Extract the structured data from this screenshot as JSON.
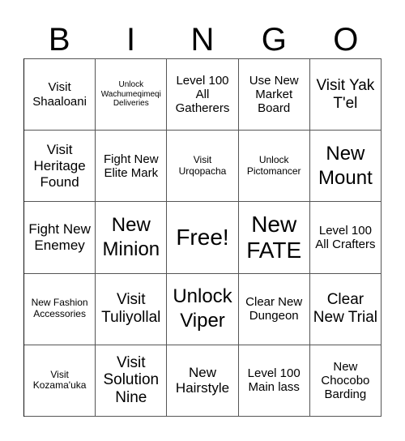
{
  "header": {
    "letters": [
      "B",
      "I",
      "N",
      "G",
      "O"
    ]
  },
  "cells": [
    [
      "Visit Shaaloani",
      "Unlock Wachumeqimeqi Deliveries",
      "Level 100 All Gatherers",
      "Use New Market Board",
      "Visit Yak T'el"
    ],
    [
      "Visit Heritage Found",
      "Fight New Elite Mark",
      "Visit Urqopacha",
      "Unlock Pictomancer",
      "New Mount"
    ],
    [
      "Fight New Enemey",
      "New Minion",
      "Free!",
      "New FATE",
      "Level 100 All Crafters"
    ],
    [
      "New Fashion Accessories",
      "Visit Tuliyollal",
      "Unlock Viper",
      "Clear New Dungeon",
      "Clear New Trial"
    ],
    [
      "Visit Kozama'uka",
      "Visit Solution Nine",
      "New Hairstyle",
      "Level 100 Main lass",
      "New Chocobo Barding"
    ]
  ]
}
